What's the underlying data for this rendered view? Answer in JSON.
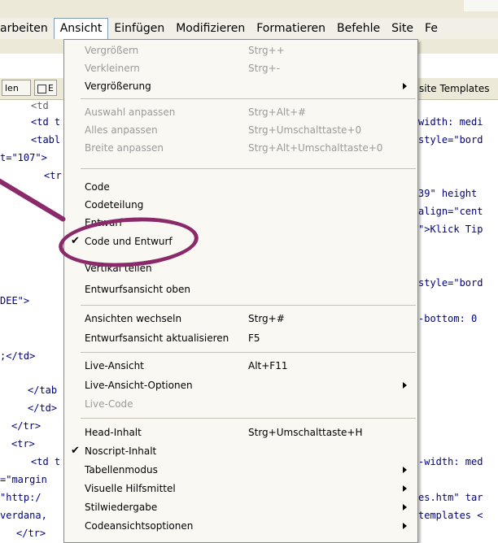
{
  "menubar": {
    "items": [
      {
        "label": "arbeiten"
      },
      {
        "label": "Ansicht"
      },
      {
        "label": "Einfügen"
      },
      {
        "label": "Modifizieren"
      },
      {
        "label": "Formatieren"
      },
      {
        "label": "Befehle"
      },
      {
        "label": "Site"
      },
      {
        "label": "Fe"
      }
    ]
  },
  "toolbar": {
    "code_btn": "len",
    "b_btn": "E",
    "site_templates_tab": "site Templates"
  },
  "code_left": [
    "<td",
    "<td t",
    "<tabl",
    "t=\"107\">",
    "<tr",
    "",
    "",
    "",
    "DEE\">",
    "",
    ";</td>",
    "",
    "</tab",
    "</td>",
    "</tr>",
    "<tr>",
    "<td t",
    "=\"margin",
    "\"http:/",
    "verdana,",
    "</tr>"
  ],
  "code_right": [
    "width: medi",
    "width: medi",
    "style=\"bord",
    "39\" height",
    "align=\"cent",
    "\">Klick Tip",
    "style=\"bord",
    "-bottom: 0",
    "-width: med",
    "es.htm\" tar",
    "templates <"
  ],
  "menu": {
    "items": [
      {
        "label": "Vergrößern",
        "shortcut": "Strg++",
        "disabled": true
      },
      {
        "label": "Verkleinern",
        "shortcut": "Strg+-",
        "disabled": true
      },
      {
        "label": "Vergrößerung",
        "shortcut": "",
        "disabled": false,
        "submenu": true
      },
      {
        "label": "Auswahl anpassen",
        "shortcut": "Strg+Alt+#",
        "disabled": true
      },
      {
        "label": "Alles anpassen",
        "shortcut": "Strg+Umschalttaste+0",
        "disabled": true
      },
      {
        "label": "Breite anpassen",
        "shortcut": "Strg+Alt+Umschalttaste+0",
        "disabled": true
      },
      {
        "label": "Code",
        "shortcut": "",
        "disabled": false
      },
      {
        "label": "Codeteilung",
        "shortcut": "",
        "disabled": false
      },
      {
        "label": "Entwurf",
        "shortcut": "",
        "disabled": false
      },
      {
        "label": "Code und Entwurf",
        "shortcut": "",
        "disabled": false,
        "checked": true
      },
      {
        "label": "Vertikal teilen",
        "shortcut": "",
        "disabled": false
      },
      {
        "label": "Entwurfsansicht oben",
        "shortcut": "",
        "disabled": false
      },
      {
        "label": "Ansichten wechseln",
        "shortcut": "Strg+#",
        "disabled": false
      },
      {
        "label": "Entwurfsansicht aktualisieren",
        "shortcut": "F5",
        "disabled": false
      },
      {
        "label": "Live-Ansicht",
        "shortcut": "Alt+F11",
        "disabled": false
      },
      {
        "label": "Live-Ansicht-Optionen",
        "shortcut": "",
        "disabled": false,
        "submenu": true
      },
      {
        "label": "Live-Code",
        "shortcut": "",
        "disabled": true
      },
      {
        "label": "Head-Inhalt",
        "shortcut": "Strg+Umschalttaste+H",
        "disabled": false
      },
      {
        "label": "Noscript-Inhalt",
        "shortcut": "",
        "disabled": false,
        "checked": true
      },
      {
        "label": "Tabellenmodus",
        "shortcut": "",
        "disabled": false,
        "submenu": true
      },
      {
        "label": "Visuelle Hilfsmittel",
        "shortcut": "",
        "disabled": false,
        "submenu": true
      },
      {
        "label": "Stilwiedergabe",
        "shortcut": "",
        "disabled": false,
        "submenu": true
      },
      {
        "label": "Codeansichtsoptionen",
        "shortcut": "",
        "disabled": false,
        "submenu": true
      }
    ]
  },
  "icons": {
    "check": "✔",
    "submenu_arrow": "chevron-right-icon"
  },
  "colors": {
    "annotation": "#8b2a6a",
    "menu_bg": "#f9f8f3",
    "menubar_bg": "#ece9d8",
    "disabled_text": "#9a9a9a"
  }
}
